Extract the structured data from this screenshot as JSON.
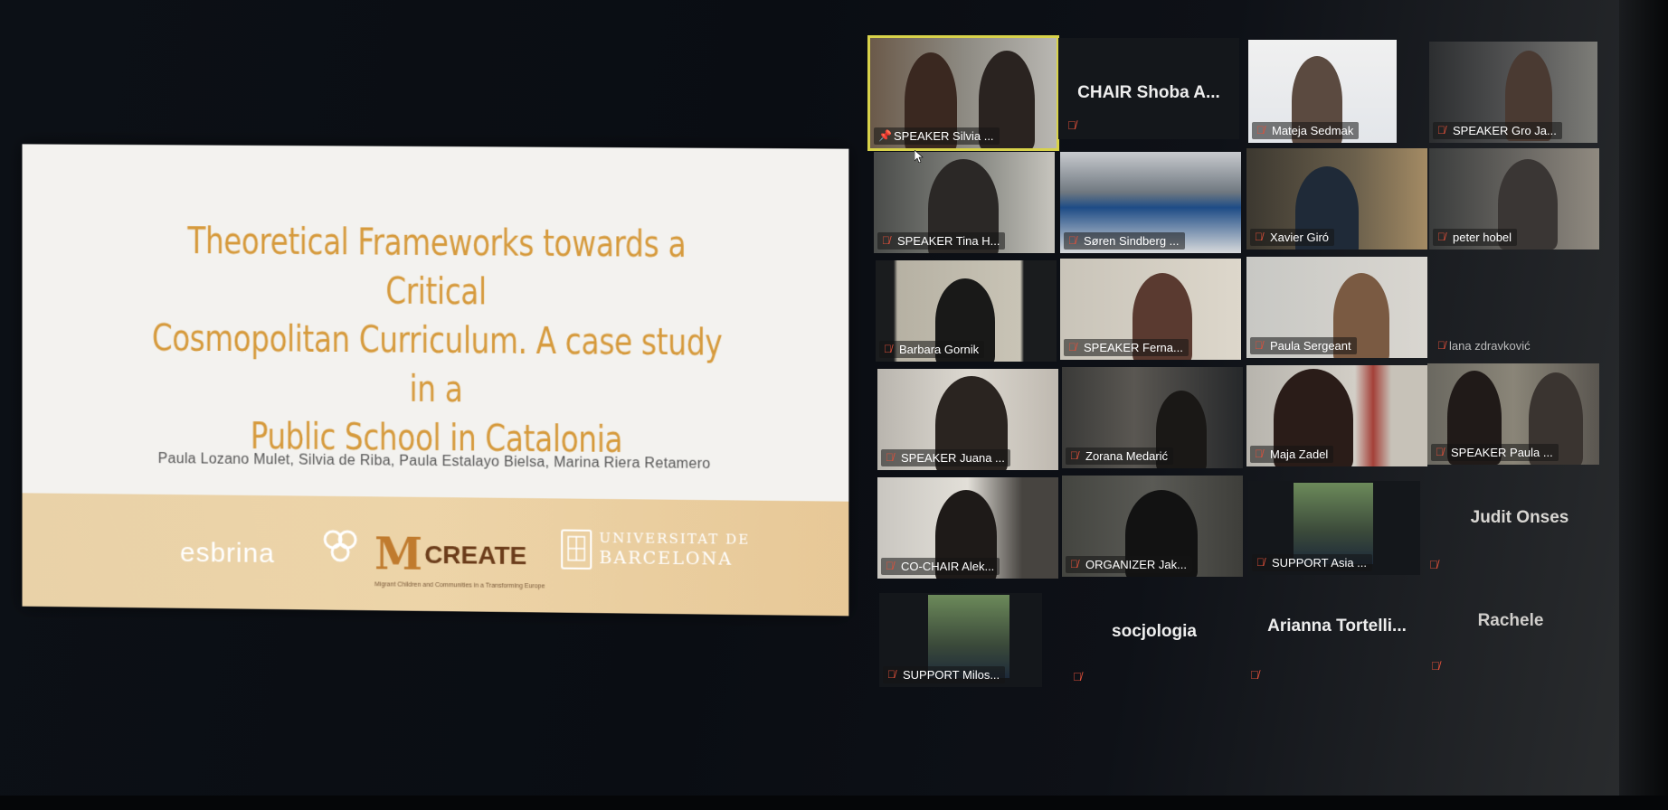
{
  "slide": {
    "title_lines": [
      "Theoretical Frameworks towards a Critical",
      "Cosmopolitan Curriculum. A case study in a",
      "Public School in Catalonia"
    ],
    "authors": "Paula Lozano Mulet, Silvia de Riba, Paula Estalayo Bielsa, Marina Riera Retamero",
    "logos": {
      "esbrina": "esbrina",
      "micreate_mark": "M",
      "micreate_text": "CREATE",
      "micreate_sub": "Migrant Children and Communities in a Transforming Europe",
      "ub_line1": "UNIVERSITAT DE",
      "ub_line2": "BARCELONA"
    }
  },
  "participants": [
    {
      "name": "SPEAKER Silvia ...",
      "type": "video",
      "active": true
    },
    {
      "name": "CHAIR Shoba A...",
      "type": "name"
    },
    {
      "name": "Mateja Sedmak",
      "type": "video"
    },
    {
      "name": "SPEAKER Gro Ja...",
      "type": "video"
    },
    {
      "name": "SPEAKER Tina H...",
      "type": "video"
    },
    {
      "name": "Søren Sindberg ...",
      "type": "video"
    },
    {
      "name": "Xavier Giró",
      "type": "video"
    },
    {
      "name": "peter hobel",
      "type": "video"
    },
    {
      "name": "Barbara Gornik",
      "type": "video"
    },
    {
      "name": "SPEAKER Ferna...",
      "type": "video"
    },
    {
      "name": "Paula Sergeant",
      "type": "video"
    },
    {
      "name": "lana zdravković",
      "type": "video"
    },
    {
      "name": "SPEAKER Juana ...",
      "type": "video"
    },
    {
      "name": "Zorana Medarić",
      "type": "video"
    },
    {
      "name": "Maja Zadel",
      "type": "video"
    },
    {
      "name": "SPEAKER Paula ...",
      "type": "video"
    },
    {
      "name": "CO-CHAIR Alek...",
      "type": "video"
    },
    {
      "name": "ORGANIZER Jak...",
      "type": "video"
    },
    {
      "name": "SUPPORT Asia ...",
      "type": "video"
    },
    {
      "name": "Judit Onses",
      "type": "name"
    },
    {
      "name": "SUPPORT Milos...",
      "type": "video"
    },
    {
      "name": "socjologia",
      "type": "name"
    },
    {
      "name": "Arianna  Tortelli...",
      "type": "name"
    },
    {
      "name": "Rachele",
      "type": "name"
    }
  ],
  "colors": {
    "title": "#d69a3c",
    "active_border": "#d8d24a",
    "muted_mic": "#e0503a"
  },
  "icons": [
    "muted-mic-icon",
    "pin-icon",
    "cursor-icon",
    "esbrina-logo-icon",
    "ub-crest-icon"
  ]
}
